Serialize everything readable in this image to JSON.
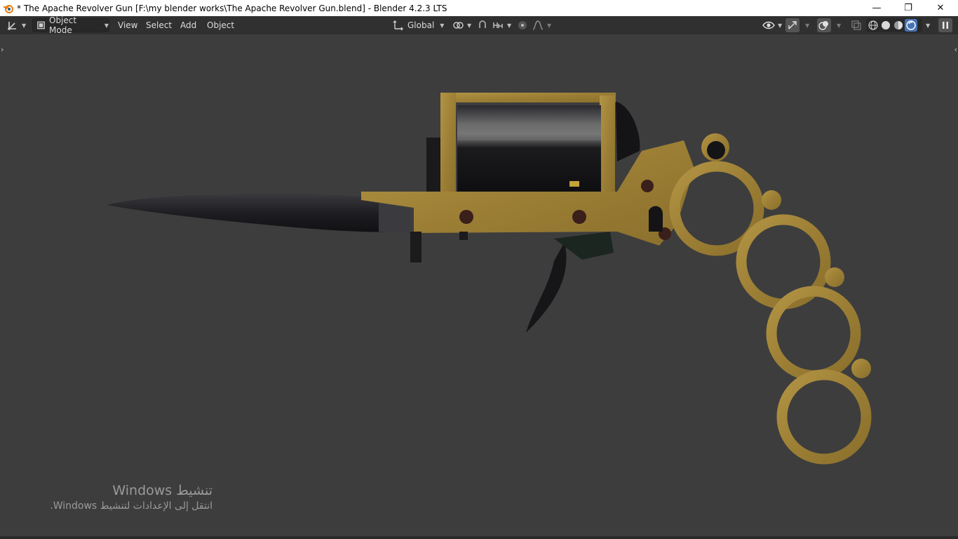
{
  "window": {
    "title": "* The Apache Revolver Gun [F:\\my blender works\\The Apache Revolver Gun.blend] - Blender 4.2.3 LTS",
    "controls": {
      "minimize": "—",
      "restore": "❐",
      "close": "✕"
    }
  },
  "header": {
    "editor_type_icon": "axes-icon",
    "mode": "Object Mode",
    "menus": [
      "View",
      "Select",
      "Add",
      "Object"
    ],
    "transform_orientation": "Global",
    "icons": [
      "pivot-icon",
      "snap-icon",
      "snap-increment-icon",
      "proportional-edit-icon",
      "falloff-icon",
      "visibility-icon",
      "gizmo-icon",
      "overlay-icon",
      "xray-icon",
      "wireframe-shading-icon",
      "solid-shading-icon",
      "material-shading-icon",
      "rendered-shading-icon",
      "pause-icon"
    ]
  },
  "viewport": {
    "object": "Apache Revolver Gun",
    "colors": {
      "background": "#3d3d3d",
      "brass": "#a98b3c",
      "steel": "#1a1a1c",
      "active_shading": "#4772b3"
    }
  },
  "watermark": {
    "line1": "تنشيط Windows",
    "line2": "انتقل إلى الإعدادات لتنشيط Windows."
  }
}
